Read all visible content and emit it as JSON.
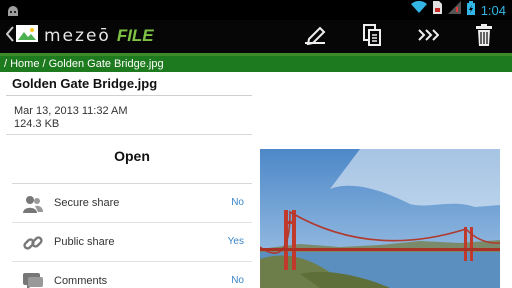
{
  "status_bar": {
    "time": "1:04",
    "icons": [
      "android-icon",
      "wifi-icon",
      "sim-icon",
      "signal-icon",
      "battery-icon"
    ]
  },
  "action_bar": {
    "brand_word": "mezeō",
    "brand_file": "FILE",
    "actions": [
      "rename-icon",
      "copy-icon",
      "forward-icon",
      "trash-icon"
    ]
  },
  "breadcrumb": "/ Home / Golden Gate Bridge.jpg",
  "file": {
    "name": "Golden Gate Bridge.jpg",
    "date": "Mar 13, 2013 11:32 AM",
    "size": "124.3 KB"
  },
  "open_label": "Open",
  "options": [
    {
      "label": "Secure share",
      "value": "No",
      "icon": "users-icon"
    },
    {
      "label": "Public share",
      "value": "Yes",
      "icon": "link-icon"
    },
    {
      "label": "Comments",
      "value": "No",
      "icon": "comment-icon"
    }
  ],
  "colors": {
    "accent_blue": "#33b5e5",
    "green_bar": "#1e7a1e",
    "value_blue": "#3a86c8"
  }
}
